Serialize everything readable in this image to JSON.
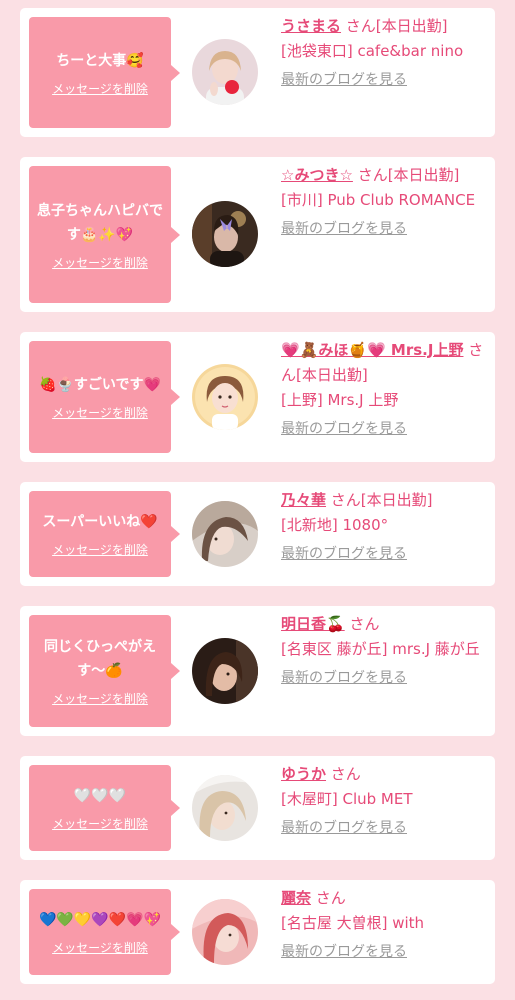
{
  "colors": {
    "page_background": "#fbe0e4",
    "card_background": "#ffffff",
    "bubble_pink": "#f99aa9",
    "name_pink": "#e64a78",
    "link_gray": "#9a9a9a"
  },
  "delete_label": "メッセージを削除",
  "blog_label": "最新のブログを見る",
  "items": [
    {
      "message": "ちーと大事🥰",
      "name": "うさまる",
      "suffix": "さん[本日出勤]",
      "shop": "[池袋東口] cafe&bar nino"
    },
    {
      "message": "息子ちゃんハピバです🎂✨💖",
      "name": "☆みつき☆",
      "suffix": "さん[本日出勤]",
      "shop": "[市川] Pub Club ROMANCE"
    },
    {
      "message": "🍓🍨すごいです💗",
      "name": "💗🧸みほ🍯💗 Mrs.J上野",
      "suffix": "さん[本日出勤]",
      "shop": "[上野] Mrs.J 上野"
    },
    {
      "message": "スーパーいいね❤️",
      "name": "乃々華",
      "suffix": "さん[本日出勤]",
      "shop": "[北新地] 1080°"
    },
    {
      "message": "同じくひっぺがえす〜🍊",
      "name": "明日香🍒",
      "suffix": "さん",
      "shop": "[名東区 藤が丘] mrs.J 藤が丘"
    },
    {
      "message": "🤍🤍🤍",
      "name": "ゆうか",
      "suffix": "さん",
      "shop": "[木屋町] Club MET"
    },
    {
      "message": "💙💚💛💜❤️💗💖",
      "name": "麗奈",
      "suffix": "さん",
      "shop": "[名古屋 大曽根] with"
    }
  ]
}
